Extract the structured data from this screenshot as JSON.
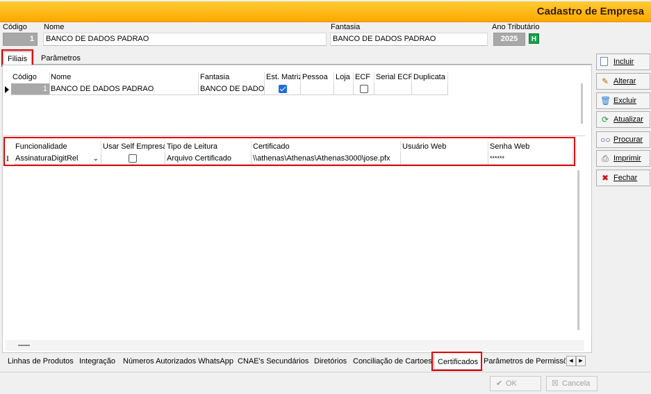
{
  "window": {
    "title": "Cadastro de Empresa"
  },
  "header": {
    "codigo_label": "Código",
    "codigo_value": "1",
    "nome_label": "Nome",
    "nome_value": "BANCO DE DADOS PADRAO",
    "fantasia_label": "Fantasia",
    "fantasia_value": "BANCO DE DADOS PADRAO",
    "ano_label": "Ano Tributário",
    "ano_value": "2025",
    "ano_button": "H"
  },
  "top_tabs": [
    "Filiais",
    "Parâmetros"
  ],
  "filiais_grid": {
    "columns": [
      "Código",
      "Nome",
      "Fantasia",
      "Est. Matriz",
      "Pessoa",
      "Loja",
      "ECF",
      "Serial ECF",
      "Duplicata"
    ],
    "row": {
      "codigo": "1",
      "nome": "BANCO DE DADOS PADRAO",
      "fantasia": "BANCO DE DADOS PADRAO",
      "est_matriz": true,
      "ecf": false
    }
  },
  "cert_grid": {
    "columns": [
      "Funcionalidade",
      "Usar Self Empresa",
      "Tipo de Leitura",
      "Certificado",
      "Usuário Web",
      "Senha Web"
    ],
    "row": {
      "funcionalidade": "AssinaturaDigitRel",
      "usar_self_empresa": false,
      "tipo_leitura": "Arquivo Certificado",
      "certificado": "\\\\athenas\\Athenas\\Athenas3000\\jose.pfx",
      "usuario_web": "",
      "senha_web": "******"
    }
  },
  "bottom_tabs": [
    "Linhas de Produtos",
    "Integração",
    "Números Autorizados WhatsApp",
    "CNAE's Secundários",
    "Diretórios",
    "Conciliação de Cartoes",
    "Certificados",
    "Parâmetros de Permissõe"
  ],
  "side_buttons": [
    {
      "label": "Incluir",
      "icon": "new-document-icon"
    },
    {
      "label": "Alterar",
      "icon": "edit-icon"
    },
    {
      "label": "Excluir",
      "icon": "delete-icon"
    },
    {
      "label": "Atualizar",
      "icon": "refresh-icon"
    },
    {
      "label": "Procurar",
      "icon": "binoculars-icon"
    },
    {
      "label": "Imprimir",
      "icon": "printer-icon"
    },
    {
      "label": "Fechar",
      "icon": "close-window-icon"
    }
  ],
  "footer": {
    "ok": "OK",
    "cancel": "Cancela"
  },
  "colors": {
    "title_bar": "#ffa800",
    "highlight": "#e10000",
    "check_blue": "#1e6fd9"
  }
}
